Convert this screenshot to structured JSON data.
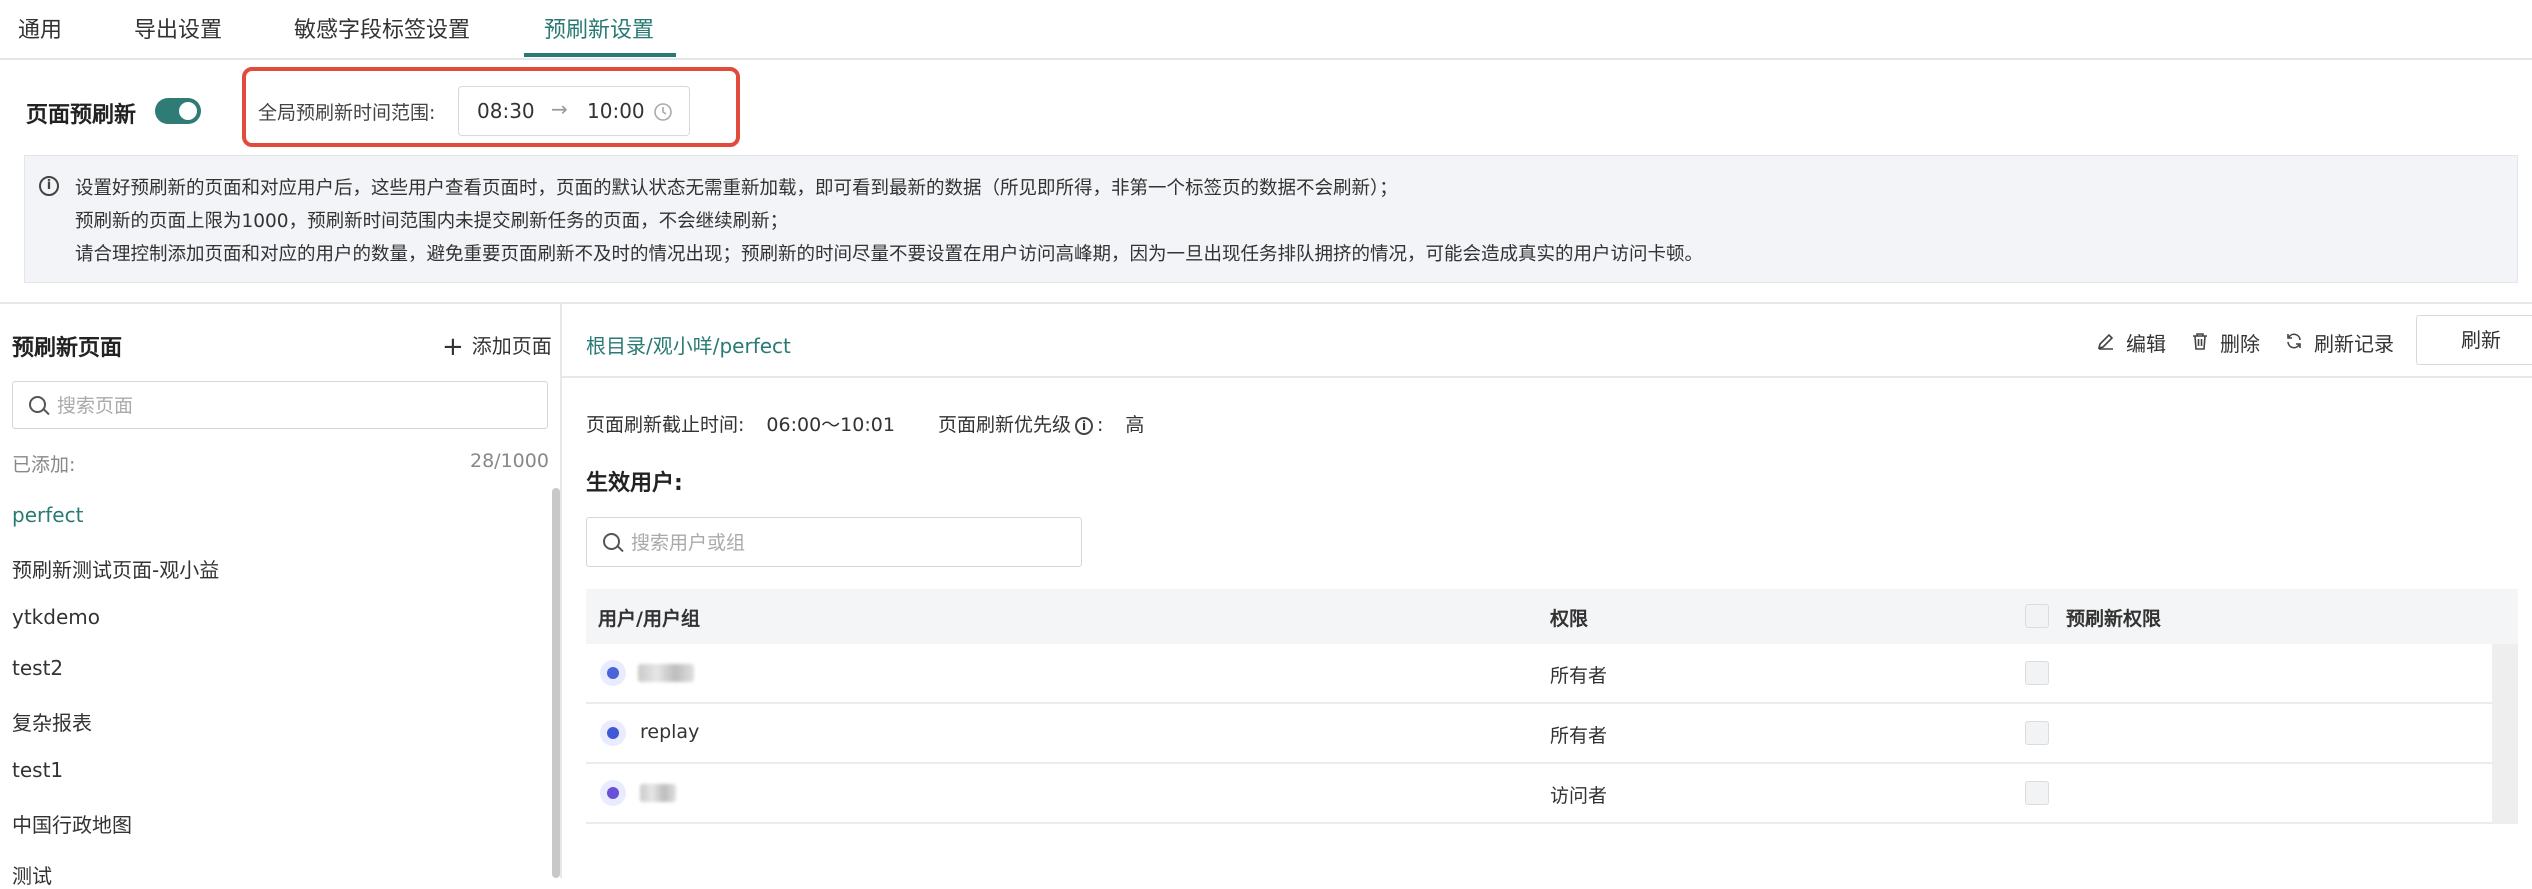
{
  "tabs": [
    {
      "label": "通用",
      "active": false
    },
    {
      "label": "导出设置",
      "active": false
    },
    {
      "label": "敏感字段标签设置",
      "active": false
    },
    {
      "label": "预刷新设置",
      "active": true
    }
  ],
  "header": {
    "title": "页面预刷新",
    "toggle_on": true,
    "range_label": "全局预刷新时间范围:",
    "range_start": "08:30",
    "range_arrow": "→",
    "range_end": "10:00"
  },
  "notice": {
    "lines": [
      "设置好预刷新的页面和对应用户后，这些用户查看页面时，页面的默认状态无需重新加载，即可看到最新的数据（所见即所得，非第一个标签页的数据不会刷新）；",
      "预刷新的页面上限为1000，预刷新时间范围内未提交刷新任务的页面，不会继续刷新；",
      "请合理控制添加页面和对应的用户的数量，避免重要页面刷新不及时的情况出现；预刷新的时间尽量不要设置在用户访问高峰期，因为一旦出现任务排队拥挤的情况，可能会造成真实的用户访问卡顿。"
    ]
  },
  "left": {
    "title": "预刷新页面",
    "add_label": "添加页面",
    "search_placeholder": "搜索页面",
    "added_label": "已添加:",
    "added_count": "28/1000",
    "pages": [
      "perfect",
      "预刷新测试页面-观小益",
      "ytkdemo",
      "test2",
      "复杂报表",
      "test1",
      "中国行政地图",
      "测试"
    ],
    "active_index": 0
  },
  "right": {
    "breadcrumb": "根目录/观小咩/perfect",
    "edit_label": "编辑",
    "delete_label": "删除",
    "history_label": "刷新记录",
    "refresh_label": "刷新",
    "deadline_label": "页面刷新截止时间:",
    "deadline_value": "06:00～10:01",
    "priority_label": "页面刷新优先级",
    "priority_value": "高",
    "effective_users_title": "生效用户:",
    "user_search_placeholder": "搜索用户或组",
    "table": {
      "headers": [
        "用户/用户组",
        "权限",
        "预刷新权限"
      ],
      "rows": [
        {
          "name": "",
          "permission": "所有者",
          "avatar_color": "#4a63d8"
        },
        {
          "name": "replay",
          "permission": "所有者",
          "avatar_color": "#3f59d4"
        },
        {
          "name": "",
          "permission": "访问者",
          "avatar_color": "#6a4fd8"
        }
      ]
    }
  }
}
